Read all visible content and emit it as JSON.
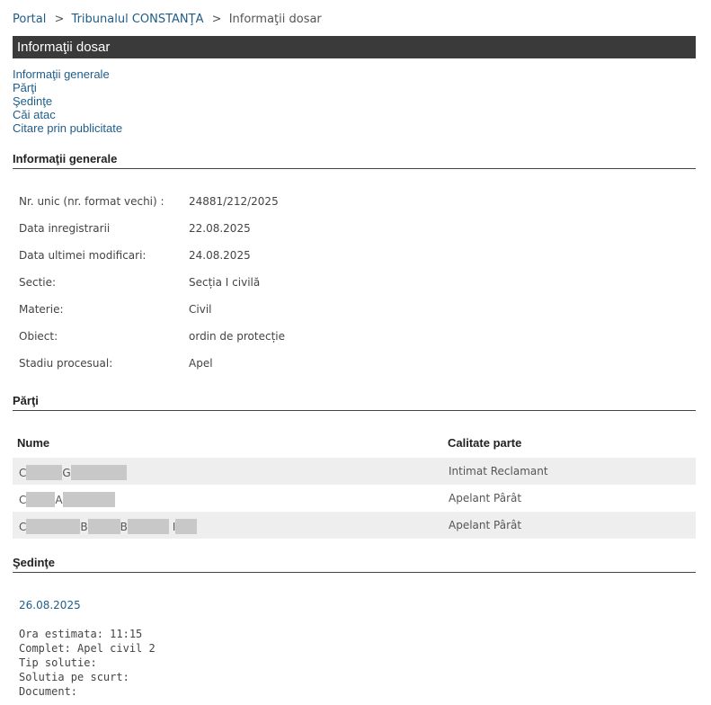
{
  "breadcrumb": {
    "portal": "Portal",
    "court": "Tribunalul CONSTANŢA",
    "current": "Informaţii dosar",
    "sep": ">"
  },
  "title": "Informaţii dosar",
  "nav": [
    "Informaţii generale",
    "Părţi",
    "Şedinţe",
    "Căi atac",
    "Citare prin publicitate"
  ],
  "general": {
    "heading": "Informaţii generale",
    "rows": [
      {
        "label": "Nr. unic (nr. format vechi) :",
        "value": "24881/212/2025"
      },
      {
        "label": "Data inregistrarii",
        "value": "22.08.2025"
      },
      {
        "label": "Data ultimei modificari:",
        "value": "24.08.2025"
      },
      {
        "label": "Sectie:",
        "value": "Secția I civilă"
      },
      {
        "label": "Materie:",
        "value": "Civil"
      },
      {
        "label": "Obiect:",
        "value": "ordin de protecție"
      },
      {
        "label": "Stadiu procesual:",
        "value": "Apel"
      }
    ]
  },
  "parti": {
    "heading": "Părţi",
    "col_name": "Nume",
    "col_role": "Calitate parte",
    "rows": [
      {
        "initials": [
          "C",
          "G"
        ],
        "role": "Intimat Reclamant"
      },
      {
        "initials": [
          "C",
          "A"
        ],
        "role": "Apelant Pârât"
      },
      {
        "initials": [
          "C",
          "B",
          "B",
          "I"
        ],
        "role": "Apelant Pârât"
      }
    ]
  },
  "sedinte": {
    "heading": "Şedinţe",
    "date": "26.08.2025",
    "lines": [
      "Ora estimata: 11:15",
      "Complet: Apel civil 2",
      "Tip solutie:",
      "Solutia pe scurt:",
      "Document:"
    ]
  }
}
